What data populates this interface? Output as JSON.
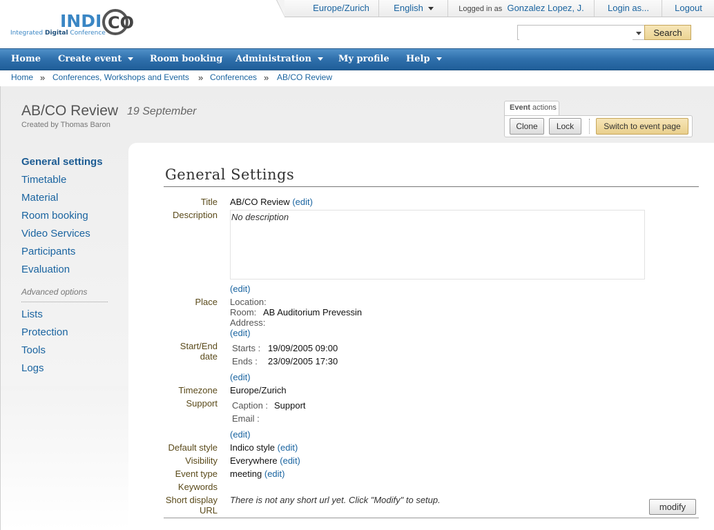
{
  "header": {
    "logo_word": "INDI",
    "logo_co": "CO",
    "logo_tagline_pre": "Integrated ",
    "logo_tagline_bold": "Digital",
    "logo_tagline_post": " Conference",
    "timezone": "Europe/Zurich",
    "language": "English",
    "logged_in_prefix": "Logged in as",
    "user": "Gonzalez Lopez, J.",
    "login_as": "Login as...",
    "logout": "Logout",
    "search_placeholder": "",
    "search_button": "Search"
  },
  "nav": {
    "items": [
      {
        "label": "Home",
        "dropdown": false
      },
      {
        "label": "Create event",
        "dropdown": true
      },
      {
        "label": "Room booking",
        "dropdown": false
      },
      {
        "label": "Administration",
        "dropdown": true
      },
      {
        "label": "My profile",
        "dropdown": false
      },
      {
        "label": "Help",
        "dropdown": true
      }
    ]
  },
  "breadcrumb": {
    "items": [
      "Home",
      "Conferences, Workshops and Events",
      "Conferences",
      "AB/CO Review"
    ],
    "separator": "»"
  },
  "event": {
    "title": "AB/CO Review",
    "date": "19 September",
    "created_by": "Created by Thomas Baron"
  },
  "event_actions": {
    "tab_bold": "Event",
    "tab_rest": " actions",
    "clone": "Clone",
    "lock": "Lock",
    "switch": "Switch to event page"
  },
  "sidebar": {
    "items": [
      "General settings",
      "Timetable",
      "Material",
      "Room booking",
      "Video Services",
      "Participants",
      "Evaluation"
    ],
    "advanced_label": "Advanced options",
    "advanced_items": [
      "Lists",
      "Protection",
      "Tools",
      "Logs"
    ]
  },
  "settings": {
    "heading": "General Settings",
    "edit": "(edit)",
    "title_label": "Title",
    "title_value": "AB/CO Review",
    "description_label": "Description",
    "description_value": "No description",
    "place_label": "Place",
    "location_key": "Location:",
    "room_key": "Room:",
    "room_value": "AB Auditorium Prevessin",
    "address_key": "Address:",
    "startend_label_1": "Start/End",
    "startend_label_2": "date",
    "starts_key": "Starts :",
    "starts_value": "19/09/2005 09:00",
    "ends_key": "Ends :",
    "ends_value": "23/09/2005 17:30",
    "timezone_label": "Timezone",
    "timezone_value": "Europe/Zurich",
    "support_label": "Support",
    "caption_key": "Caption :",
    "caption_value": "Support",
    "email_key": "Email :",
    "default_style_label": "Default style",
    "default_style_value": "Indico style",
    "visibility_label": "Visibility",
    "visibility_value": "Everywhere",
    "event_type_label": "Event type",
    "event_type_value": "meeting",
    "keywords_label": "Keywords",
    "short_url_label_1": "Short display",
    "short_url_label_2": "URL",
    "short_url_message": "There is not any short url yet. Click \"Modify\" to setup.",
    "modify": "modify"
  },
  "colors": {
    "nav_blue": "#2f6fab",
    "link_blue": "#1a64a0",
    "label_brown": "#5a4a1a",
    "gold_button": "#ecd493"
  }
}
